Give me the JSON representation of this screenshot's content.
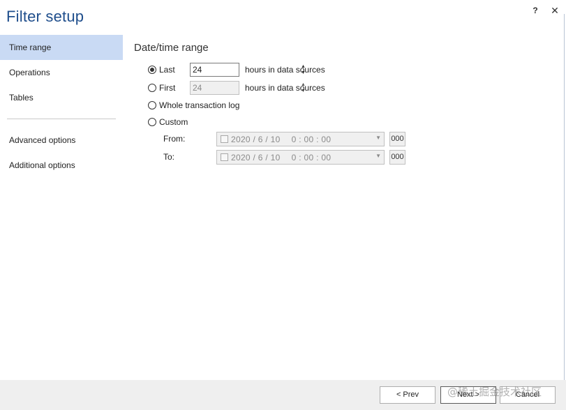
{
  "window": {
    "title": "Filter setup",
    "help_label": "?",
    "close_label": "✕"
  },
  "sidebar": {
    "items": [
      {
        "label": "Time range",
        "active": true
      },
      {
        "label": "Operations"
      },
      {
        "label": "Tables"
      },
      {
        "label": "Advanced options"
      },
      {
        "label": "Additional options"
      }
    ]
  },
  "main": {
    "section_title": "Date/time range",
    "last": {
      "label": "Last",
      "value": "24",
      "suffix": "hours in data sources",
      "checked": true
    },
    "first": {
      "label": "First",
      "value": "24",
      "suffix": "hours in data sources",
      "checked": false
    },
    "whole_log": {
      "label": "Whole transaction log",
      "checked": false
    },
    "custom": {
      "label": "Custom",
      "checked": false
    },
    "from": {
      "label": "From:",
      "date": "2020 /   6 / 10",
      "time": "0 : 00 : 00",
      "ms": "000"
    },
    "to": {
      "label": "To:",
      "date": "2020 /   6 / 10",
      "time": "0 : 00 : 00",
      "ms": "000"
    }
  },
  "footer": {
    "prev_label": "< Prev",
    "next_label": "Next >",
    "cancel_label": "Cancel",
    "watermark": "@稀土掘金技术社区"
  }
}
